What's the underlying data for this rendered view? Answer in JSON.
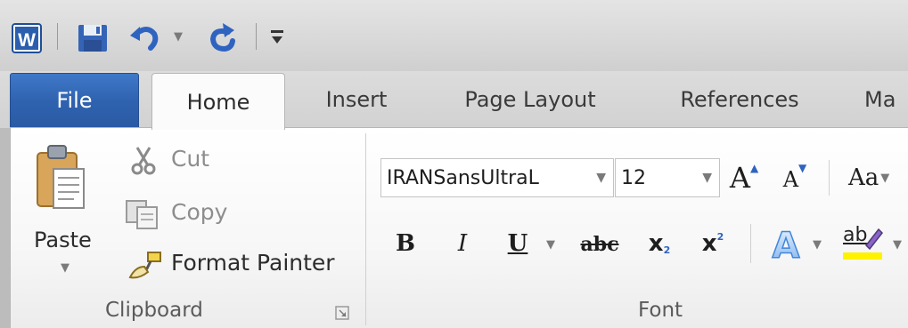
{
  "tabs": {
    "file": "File",
    "home": "Home",
    "insert": "Insert",
    "page_layout": "Page Layout",
    "references": "References",
    "mailings_partial": "Ma"
  },
  "clipboard": {
    "paste": "Paste",
    "cut": "Cut",
    "copy": "Copy",
    "format_painter": "Format Painter",
    "group_label": "Clipboard"
  },
  "font": {
    "font_name": "IRANSansUltraL",
    "font_size": "12",
    "grow_font": "A",
    "shrink_font": "A",
    "change_case": "Aa",
    "bold": "B",
    "italic": "I",
    "underline": "U",
    "strikethrough": "abc",
    "subscript": "x",
    "subscript_mark": "2",
    "superscript": "x",
    "superscript_mark": "2",
    "text_effects": "A",
    "highlight": "ab",
    "group_label": "Font"
  },
  "colors": {
    "file_tab": "#2f63b0",
    "word_icon": "#2b5fad",
    "highlight_yellow": "#fff200"
  }
}
